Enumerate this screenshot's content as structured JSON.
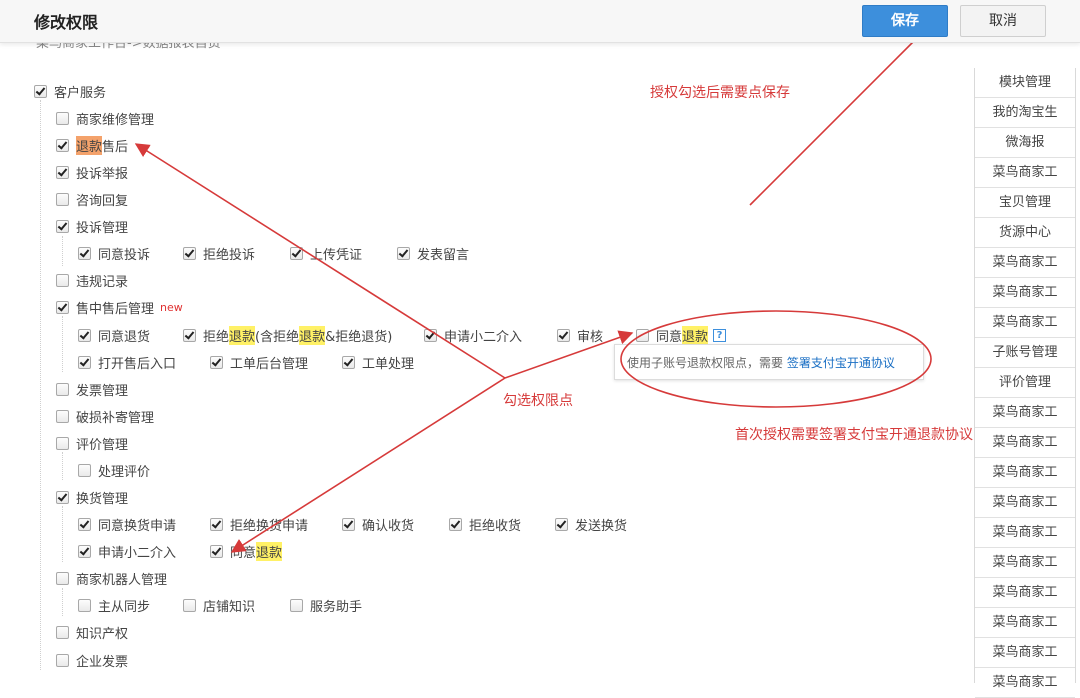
{
  "dialog": {
    "title": "修改权限",
    "save_label": "保存",
    "cancel_label": "取消"
  },
  "cutoff_text": "菜鸟商家工作台->数据报表自贸",
  "tree": {
    "root_label": "客户服务",
    "items": {
      "repair": "商家维修管理",
      "refund_after_sale_pre": "退款",
      "refund_after_sale_post": "售后",
      "complaint_report": "投诉举报",
      "inquiry_reply": "咨询回复",
      "complaint_mgmt": "投诉管理",
      "agree_complaint": "同意投诉",
      "reject_complaint": "拒绝投诉",
      "upload_voucher": "上传凭证",
      "post_message": "发表留言",
      "violation_record": "违规记录",
      "in_after_sale_mgmt": "售中售后管理",
      "new_tag": "new",
      "agree_return": "同意退货",
      "reject_refund_pre": "拒绝",
      "reject_refund_hl1": "退款",
      "reject_refund_mid": "(含拒绝",
      "reject_refund_hl2": "退款",
      "reject_refund_post": "&拒绝退货)",
      "apply_intervene": "申请小二介入",
      "review": "审核",
      "agree_refund_pre": "同意",
      "agree_refund_hl": "退款",
      "help_icon_text": "?",
      "open_after_sale_entry": "打开售后入口",
      "ticket_backend": "工单后台管理",
      "ticket_process": "工单处理",
      "invoice_mgmt": "发票管理",
      "damage_comp_mgmt": "破损补寄管理",
      "review_mgmt": "评价管理",
      "process_review": "处理评价",
      "exchange_mgmt": "换货管理",
      "agree_exchange_apply": "同意换货申请",
      "reject_exchange_apply": "拒绝换货申请",
      "confirm_receipt": "确认收货",
      "reject_receipt": "拒绝收货",
      "send_exchange": "发送换货",
      "apply_intervene_2": "申请小二介入",
      "agree_refund2_pre": "同意",
      "agree_refund2_hl": "退款",
      "robot_mgmt": "商家机器人管理",
      "master_slave_sync": "主从同步",
      "store_knowledge": "店铺知识",
      "service_assistant": "服务助手",
      "ip": "知识产权",
      "enterprise_invoice": "企业发票"
    }
  },
  "tooltip": {
    "text": "使用子账号退款权限点，需要",
    "link": "签署支付宝开通协议"
  },
  "right_panel": {
    "items": [
      "模块管理",
      "我的淘宝生",
      "微海报",
      "菜鸟商家工",
      "宝贝管理",
      "货源中心",
      "菜鸟商家工",
      "菜鸟商家工",
      "菜鸟商家工",
      "子账号管理",
      "评价管理",
      "菜鸟商家工",
      "菜鸟商家工",
      "菜鸟商家工",
      "菜鸟商家工",
      "菜鸟商家工",
      "菜鸟商家工",
      "菜鸟商家工",
      "菜鸟商家工",
      "菜鸟商家工",
      "菜鸟商家工"
    ]
  },
  "annotations": {
    "save_hint": "授权勾选后需要点保存",
    "select_hint": "勾选权限点",
    "first_auth_hint": "首次授权需要签署支付宝开通退款协议"
  },
  "colors": {
    "annotation_red": "#d63a3a",
    "save_blue": "#3d8fdc",
    "highlight_orange": "#f4a26b",
    "highlight_yellow": "#fff166"
  },
  "icons": [
    "checkbox-icon",
    "help-icon",
    "arrow-icon"
  ]
}
